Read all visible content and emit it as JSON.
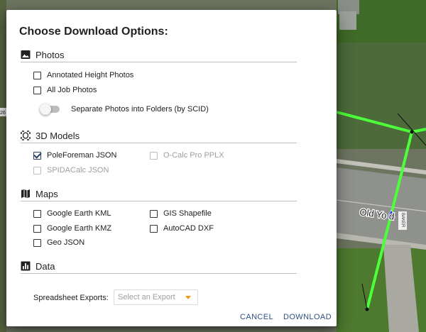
{
  "dialog": {
    "title": "Choose Download Options:",
    "sections": {
      "photos": {
        "label": "Photos",
        "icon": "image-icon",
        "options": [
          {
            "label": "Annotated Height Photos",
            "checked": false
          },
          {
            "label": "All Job Photos",
            "checked": false
          }
        ],
        "toggle": {
          "label": "Separate Photos into Folders (by SCID)",
          "on": false
        }
      },
      "models": {
        "label": "3D Models",
        "icon": "3d-models-icon",
        "options": [
          {
            "label": "PoleForeman JSON",
            "checked": true,
            "disabled": false
          },
          {
            "label": "O-Calc Pro PPLX",
            "checked": false,
            "disabled": true
          },
          {
            "label": "SPIDACalc JSON",
            "checked": false,
            "disabled": true
          }
        ]
      },
      "maps": {
        "label": "Maps",
        "icon": "map-icon",
        "options": [
          {
            "label": "Google Earth KML",
            "checked": false
          },
          {
            "label": "GIS Shapefile",
            "checked": false
          },
          {
            "label": "Google Earth KMZ",
            "checked": false
          },
          {
            "label": "AutoCAD DXF",
            "checked": false
          },
          {
            "label": "Geo JSON",
            "checked": false
          }
        ]
      },
      "data": {
        "label": "Data",
        "icon": "bar-chart-icon",
        "spreadsheet_label": "Spreadsheet Exports:",
        "select_placeholder": "Select an Export"
      }
    },
    "actions": {
      "cancel": "CANCEL",
      "download": "DOWNLOAD"
    }
  },
  "map": {
    "street_label": "Old Yo    d",
    "sign_label": "BAKER",
    "edge_label": "26",
    "colors": {
      "line": "#4cff3a",
      "marker": "#2a3fd6"
    }
  }
}
